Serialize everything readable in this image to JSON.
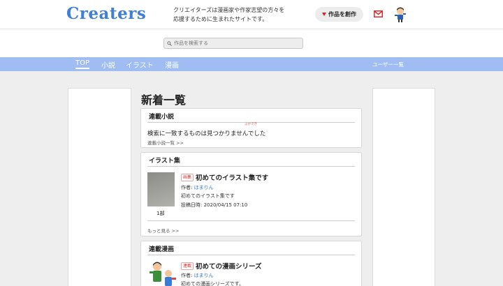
{
  "header": {
    "logo": "Creaters",
    "tagline_line1": "クリエイターズは漫画家や作家志望の方々を",
    "tagline_line2": "応援するために生まれたサイトです。",
    "create_button": "作品を創作"
  },
  "search": {
    "placeholder": "作品を検索する"
  },
  "nav": {
    "items": [
      {
        "label": "TOP"
      },
      {
        "label": "小説"
      },
      {
        "label": "イラスト"
      },
      {
        "label": "漫画"
      }
    ],
    "users_link": "ユーザー一覧"
  },
  "main": {
    "title": "新着一覧",
    "novels": {
      "title": "連載小説",
      "empty_message": "検索に一致するものは見つかりませんでした",
      "furigana": "ふかでき",
      "list_link": "連載小説一覧 >>"
    },
    "illust": {
      "title": "イラスト集",
      "badge": "画集",
      "item_title": "初めてのイラスト集です",
      "author_prefix": "作者:",
      "author": "ほまりん",
      "description": "初めてのイラスト集です",
      "date_label": "投稿日時: 2020/04/15 07:10",
      "parts": "1部",
      "more_link": "もっと見る >>"
    },
    "manga": {
      "title": "連載漫画",
      "badge": "連載",
      "item_title": "初めての漫画シリーズ",
      "author_prefix": "作者:",
      "author": "ほまりん",
      "description": "初めての漫画シリーズです。"
    }
  },
  "colors": {
    "brand": "#3f7fd4",
    "nav_bg": "#9fbdf3",
    "badge_red": "#d33333"
  },
  "icons": [
    "mail-icon",
    "avatar-icon",
    "search-icon",
    "dropdown-triangle-icon"
  ]
}
